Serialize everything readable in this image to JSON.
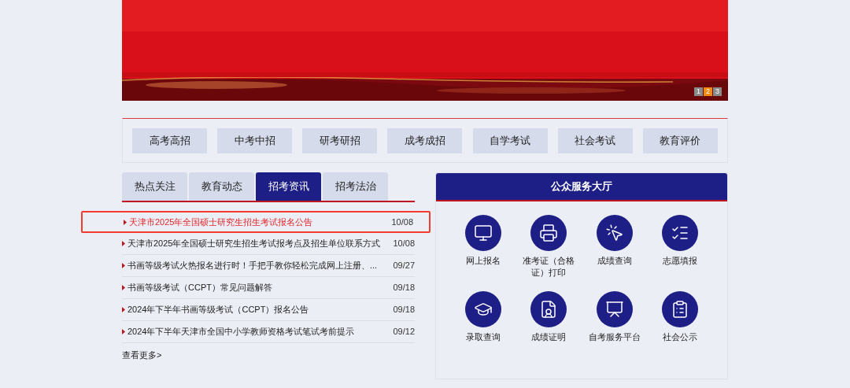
{
  "banner": {
    "pager": [
      {
        "label": "1",
        "selected": false
      },
      {
        "label": "2",
        "selected": true
      },
      {
        "label": "3",
        "selected": false
      }
    ]
  },
  "categories": [
    "高考高招",
    "中考中招",
    "研考研招",
    "成考成招",
    "自学考试",
    "社会考试",
    "教育评价"
  ],
  "news": {
    "tabs": [
      {
        "label": "热点关注",
        "selected": false
      },
      {
        "label": "教育动态",
        "selected": false
      },
      {
        "label": "招考资讯",
        "selected": true
      },
      {
        "label": "招考法治",
        "selected": false
      }
    ],
    "items": [
      {
        "title": "天津市2025年全国硕士研究生招生考试报名公告",
        "date": "10/08",
        "highlighted": true
      },
      {
        "title": "天津市2025年全国硕士研究生招生考试报考点及招生单位联系方式",
        "date": "10/08",
        "highlighted": false
      },
      {
        "title": "书画等级考试火热报名进行时！手把手教你轻松完成网上注册、...",
        "date": "09/27",
        "highlighted": false
      },
      {
        "title": "书画等级考试（CCPT）常见问题解答",
        "date": "09/18",
        "highlighted": false
      },
      {
        "title": "2024年下半年书画等级考试（CCPT）报名公告",
        "date": "09/18",
        "highlighted": false
      },
      {
        "title": "2024年下半年天津市全国中小学教师资格考试笔试考前提示",
        "date": "09/12",
        "highlighted": false
      }
    ],
    "more": "查看更多>"
  },
  "services": {
    "title": "公众服务大厅",
    "items": [
      "网上报名",
      "准考证（合格证）打印",
      "成绩查询",
      "志愿填报",
      "录取查询",
      "成绩证明",
      "自考服务平台",
      "社会公示"
    ]
  }
}
